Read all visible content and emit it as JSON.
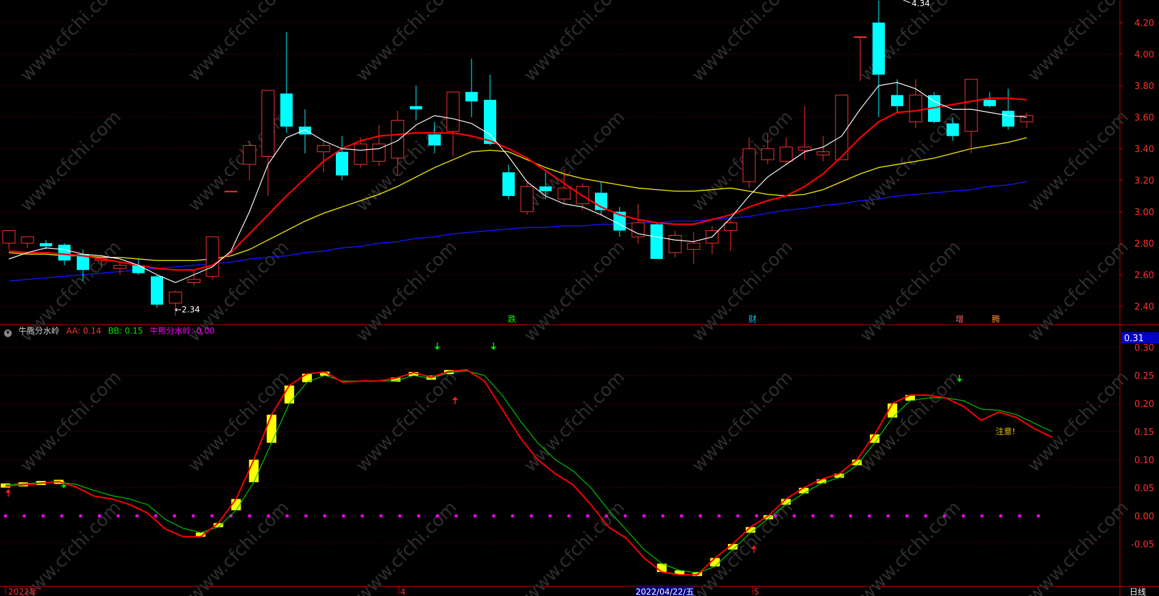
{
  "indicator": {
    "icon": "collapse-circle-icon",
    "name": "牛熊分水岭",
    "aa_label": "AA: 0.14",
    "bb_label": "BB: 0.15",
    "line_label": "牛熊分水岭: 0.00",
    "current_value": "0.31",
    "note": "注意!"
  },
  "date_axis": {
    "year_label": "2022年",
    "month4": "4",
    "cursor_date": "2022/04/22/五",
    "month5": "5",
    "period": "日线"
  },
  "events": [
    "跌",
    "财",
    "增",
    "腾"
  ],
  "annotations": {
    "low": "←2.34",
    "high": "4.34"
  },
  "watermark": "www.cfchi.com",
  "colors": {
    "bg": "#000000",
    "up": "#ff3232",
    "down": "#00ffff",
    "ma5": "#ffffff",
    "ma10": "#ff0000",
    "ma20": "#e8e000",
    "ma60": "#1414ff",
    "aa": "#ff0000",
    "bb": "#00c800",
    "bar": "#ffff00",
    "zero": "#ff00ff",
    "grid": "#7a0000",
    "axis": "#c80000"
  },
  "chart_data": [
    {
      "type": "candlestick",
      "ylim": [
        2.3,
        4.3
      ],
      "y_ticks": [
        2.4,
        2.6,
        2.8,
        3.0,
        3.2,
        3.4,
        3.6,
        3.8,
        4.0,
        4.2
      ],
      "candles": [
        {
          "o": 2.8,
          "h": 2.86,
          "l": 2.76,
          "c": 2.88
        },
        {
          "o": 2.8,
          "h": 2.84,
          "l": 2.77,
          "c": 2.84
        },
        {
          "o": 2.8,
          "h": 2.82,
          "l": 2.76,
          "c": 2.78
        },
        {
          "o": 2.79,
          "h": 2.8,
          "l": 2.66,
          "c": 2.69
        },
        {
          "o": 2.73,
          "h": 2.76,
          "l": 2.56,
          "c": 2.63
        },
        {
          "o": 2.69,
          "h": 2.72,
          "l": 2.64,
          "c": 2.7
        },
        {
          "o": 2.64,
          "h": 2.68,
          "l": 2.6,
          "c": 2.66
        },
        {
          "o": 2.66,
          "h": 2.7,
          "l": 2.6,
          "c": 2.61
        },
        {
          "o": 2.59,
          "h": 2.6,
          "l": 2.39,
          "c": 2.41
        },
        {
          "o": 2.42,
          "h": 2.5,
          "l": 2.34,
          "c": 2.49
        },
        {
          "o": 2.55,
          "h": 2.62,
          "l": 2.53,
          "c": 2.57
        },
        {
          "o": 2.59,
          "h": 2.84,
          "l": 2.57,
          "c": 2.84
        },
        {
          "o": 3.13,
          "h": 3.13,
          "l": 3.13,
          "c": 3.13
        },
        {
          "o": 3.3,
          "h": 3.45,
          "l": 3.2,
          "c": 3.42
        },
        {
          "o": 3.35,
          "h": 3.77,
          "l": 3.1,
          "c": 3.77
        },
        {
          "o": 3.75,
          "h": 4.14,
          "l": 3.5,
          "c": 3.54
        },
        {
          "o": 3.54,
          "h": 3.65,
          "l": 3.37,
          "c": 3.49
        },
        {
          "o": 3.38,
          "h": 3.45,
          "l": 3.25,
          "c": 3.42
        },
        {
          "o": 3.38,
          "h": 3.48,
          "l": 3.2,
          "c": 3.23
        },
        {
          "o": 3.3,
          "h": 3.47,
          "l": 3.28,
          "c": 3.43
        },
        {
          "o": 3.32,
          "h": 3.55,
          "l": 3.29,
          "c": 3.43
        },
        {
          "o": 3.34,
          "h": 3.64,
          "l": 3.23,
          "c": 3.58
        },
        {
          "o": 3.67,
          "h": 3.8,
          "l": 3.58,
          "c": 3.65
        },
        {
          "o": 3.49,
          "h": 3.57,
          "l": 3.37,
          "c": 3.42
        },
        {
          "o": 3.51,
          "h": 3.76,
          "l": 3.35,
          "c": 3.76
        },
        {
          "o": 3.76,
          "h": 3.97,
          "l": 3.6,
          "c": 3.7
        },
        {
          "o": 3.71,
          "h": 3.87,
          "l": 3.42,
          "c": 3.43
        },
        {
          "o": 3.25,
          "h": 3.3,
          "l": 3.08,
          "c": 3.1
        },
        {
          "o": 3.0,
          "h": 3.19,
          "l": 2.98,
          "c": 3.16
        },
        {
          "o": 3.16,
          "h": 3.25,
          "l": 3.08,
          "c": 3.13
        },
        {
          "o": 3.08,
          "h": 3.27,
          "l": 3.05,
          "c": 3.15
        },
        {
          "o": 3.05,
          "h": 3.18,
          "l": 3.01,
          "c": 3.16
        },
        {
          "o": 3.12,
          "h": 3.19,
          "l": 2.98,
          "c": 3.01
        },
        {
          "o": 3.0,
          "h": 3.03,
          "l": 2.84,
          "c": 2.88
        },
        {
          "o": 2.84,
          "h": 3.05,
          "l": 2.8,
          "c": 2.93
        },
        {
          "o": 2.92,
          "h": 2.93,
          "l": 2.7,
          "c": 2.7
        },
        {
          "o": 2.74,
          "h": 2.88,
          "l": 2.71,
          "c": 2.85
        },
        {
          "o": 2.76,
          "h": 2.87,
          "l": 2.67,
          "c": 2.8
        },
        {
          "o": 2.8,
          "h": 2.91,
          "l": 2.73,
          "c": 2.88
        },
        {
          "o": 2.88,
          "h": 2.95,
          "l": 2.75,
          "c": 2.93
        },
        {
          "o": 3.19,
          "h": 3.47,
          "l": 3.15,
          "c": 3.4
        },
        {
          "o": 3.33,
          "h": 3.5,
          "l": 3.3,
          "c": 3.4
        },
        {
          "o": 3.32,
          "h": 3.47,
          "l": 3.3,
          "c": 3.41
        },
        {
          "o": 3.39,
          "h": 3.67,
          "l": 3.33,
          "c": 3.41
        },
        {
          "o": 3.36,
          "h": 3.48,
          "l": 3.32,
          "c": 3.38
        },
        {
          "o": 3.33,
          "h": 3.74,
          "l": 3.33,
          "c": 3.74
        },
        {
          "o": 4.11,
          "h": 4.11,
          "l": 3.83,
          "c": 4.11
        },
        {
          "o": 4.2,
          "h": 4.34,
          "l": 3.6,
          "c": 3.87
        },
        {
          "o": 3.74,
          "h": 3.84,
          "l": 3.63,
          "c": 3.67
        },
        {
          "o": 3.57,
          "h": 3.84,
          "l": 3.53,
          "c": 3.74
        },
        {
          "o": 3.74,
          "h": 3.76,
          "l": 3.56,
          "c": 3.57
        },
        {
          "o": 3.56,
          "h": 3.6,
          "l": 3.45,
          "c": 3.48
        },
        {
          "o": 3.51,
          "h": 3.84,
          "l": 3.37,
          "c": 3.84
        },
        {
          "o": 3.71,
          "h": 3.76,
          "l": 3.66,
          "c": 3.67
        },
        {
          "o": 3.64,
          "h": 3.78,
          "l": 3.52,
          "c": 3.54
        },
        {
          "o": 3.57,
          "h": 3.63,
          "l": 3.53,
          "c": 3.61
        }
      ],
      "ma5": [
        2.7,
        2.74,
        2.77,
        2.76,
        2.73,
        2.72,
        2.7,
        2.66,
        2.6,
        2.55,
        2.6,
        2.65,
        2.75,
        3.0,
        3.3,
        3.47,
        3.52,
        3.45,
        3.4,
        3.39,
        3.4,
        3.45,
        3.55,
        3.61,
        3.59,
        3.56,
        3.49,
        3.35,
        3.19,
        3.1,
        3.05,
        3.03,
        2.98,
        2.92,
        2.86,
        2.84,
        2.82,
        2.81,
        2.84,
        2.96,
        3.1,
        3.22,
        3.3,
        3.38,
        3.41,
        3.48,
        3.65,
        3.8,
        3.82,
        3.78,
        3.7,
        3.65,
        3.65,
        3.63,
        3.61,
        3.6
      ],
      "ma10": [
        2.75,
        2.74,
        2.74,
        2.73,
        2.72,
        2.7,
        2.68,
        2.66,
        2.64,
        2.63,
        2.63,
        2.66,
        2.74,
        2.86,
        2.98,
        3.1,
        3.21,
        3.32,
        3.4,
        3.45,
        3.48,
        3.49,
        3.5,
        3.5,
        3.5,
        3.48,
        3.45,
        3.4,
        3.34,
        3.26,
        3.18,
        3.1,
        3.03,
        2.98,
        2.95,
        2.93,
        2.92,
        2.92,
        2.95,
        2.98,
        3.03,
        3.07,
        3.1,
        3.16,
        3.24,
        3.35,
        3.47,
        3.57,
        3.63,
        3.64,
        3.66,
        3.68,
        3.7,
        3.72,
        3.72,
        3.71
      ],
      "ma20": [
        2.74,
        2.73,
        2.73,
        2.72,
        2.72,
        2.71,
        2.71,
        2.7,
        2.69,
        2.69,
        2.69,
        2.7,
        2.72,
        2.76,
        2.82,
        2.88,
        2.94,
        2.99,
        3.03,
        3.07,
        3.11,
        3.16,
        3.22,
        3.28,
        3.33,
        3.38,
        3.39,
        3.38,
        3.33,
        3.28,
        3.24,
        3.21,
        3.19,
        3.17,
        3.15,
        3.14,
        3.13,
        3.13,
        3.14,
        3.15,
        3.13,
        3.11,
        3.1,
        3.11,
        3.14,
        3.19,
        3.24,
        3.28,
        3.3,
        3.32,
        3.34,
        3.37,
        3.4,
        3.42,
        3.44,
        3.47
      ],
      "ma60": [
        2.56,
        2.57,
        2.58,
        2.59,
        2.6,
        2.61,
        2.62,
        2.63,
        2.64,
        2.65,
        2.66,
        2.67,
        2.68,
        2.7,
        2.71,
        2.72,
        2.74,
        2.75,
        2.77,
        2.78,
        2.8,
        2.81,
        2.83,
        2.84,
        2.86,
        2.87,
        2.88,
        2.89,
        2.9,
        2.9,
        2.91,
        2.91,
        2.92,
        2.92,
        2.93,
        2.93,
        2.94,
        2.94,
        2.95,
        2.96,
        2.97,
        2.99,
        3.01,
        3.02,
        3.04,
        3.05,
        3.07,
        3.08,
        3.1,
        3.11,
        3.12,
        3.13,
        3.14,
        3.16,
        3.17,
        3.19
      ]
    },
    {
      "type": "line",
      "title": "牛熊分水岭",
      "ylim": [
        -0.13,
        0.32
      ],
      "y_ticks": [
        -0.05,
        0.0,
        0.05,
        0.1,
        0.15,
        0.2,
        0.25,
        0.3
      ],
      "series": [
        {
          "name": "AA",
          "values": [
            0.053,
            0.055,
            0.058,
            0.061,
            0.051,
            0.035,
            0.03,
            0.02,
            0.005,
            -0.023,
            -0.037,
            -0.037,
            -0.013,
            0.03,
            0.1,
            0.18,
            0.232,
            0.253,
            0.256,
            0.238,
            0.24,
            0.24,
            0.245,
            0.255,
            0.247,
            0.257,
            0.26,
            0.24,
            0.19,
            0.14,
            0.1,
            0.075,
            0.055,
            0.02,
            -0.02,
            -0.04,
            -0.075,
            -0.1,
            -0.105,
            -0.105,
            -0.075,
            -0.05,
            -0.02,
            0.0,
            0.03,
            0.05,
            0.065,
            0.075,
            0.1,
            0.145,
            0.2,
            0.215,
            0.215,
            0.21,
            0.195,
            0.17,
            0.185,
            0.175,
            0.155,
            0.14
          ]
        },
        {
          "name": "BB",
          "values": [
            0.055,
            0.057,
            0.059,
            0.06,
            0.056,
            0.045,
            0.036,
            0.03,
            0.02,
            -0.006,
            -0.022,
            -0.03,
            -0.02,
            0.01,
            0.06,
            0.13,
            0.2,
            0.238,
            0.25,
            0.24,
            0.24,
            0.24,
            0.24,
            0.25,
            0.245,
            0.255,
            0.258,
            0.25,
            0.215,
            0.17,
            0.13,
            0.1,
            0.08,
            0.05,
            0.01,
            -0.025,
            -0.06,
            -0.085,
            -0.097,
            -0.102,
            -0.09,
            -0.06,
            -0.03,
            -0.005,
            0.02,
            0.04,
            0.058,
            0.068,
            0.09,
            0.13,
            0.175,
            0.205,
            0.21,
            0.21,
            0.205,
            0.19,
            0.188,
            0.18,
            0.165,
            0.15
          ]
        },
        {
          "name": "牛熊分水岭",
          "values": [
            0
          ]
        }
      ]
    }
  ]
}
